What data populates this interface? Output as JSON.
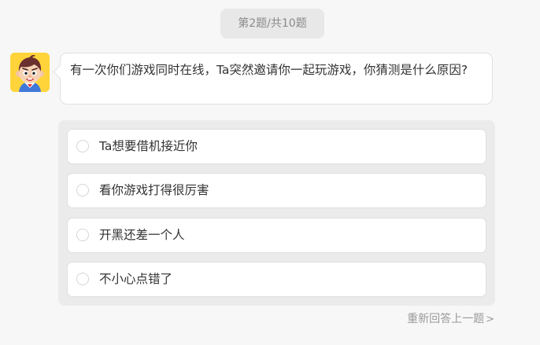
{
  "progress": {
    "text": "第2题/共10题"
  },
  "question": {
    "text": "有一次你们游戏同时在线，Ta突然邀请你一起玩游戏，你猜测是什么原因?"
  },
  "options": [
    {
      "label": "Ta想要借机接近你"
    },
    {
      "label": "看你游戏打得很厉害"
    },
    {
      "label": "开黑还差一个人"
    },
    {
      "label": "不小心点错了"
    }
  ],
  "footer": {
    "prev_label": "重新回答上一题",
    "prev_chevron": ">"
  },
  "colors": {
    "background": "#f7f7f7",
    "panel": "#ebebeb",
    "avatar_bg": "#ffd43a",
    "text": "#333333",
    "muted": "#9a9a9a"
  },
  "icons": {
    "avatar": "cartoon-boy-avatar",
    "radio": "radio-circle-icon",
    "chevron": "chevron-right-icon"
  }
}
